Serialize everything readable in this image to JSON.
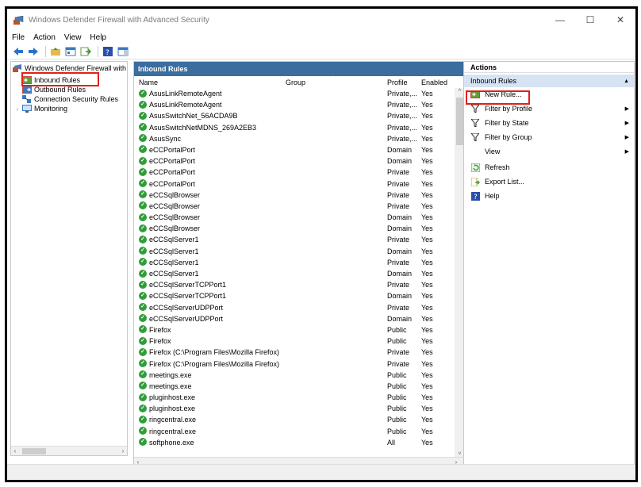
{
  "window": {
    "title": "Windows Defender Firewall with Advanced Security",
    "minimize": "—",
    "maximize": "☐",
    "close": "✕"
  },
  "menu": [
    "File",
    "Action",
    "View",
    "Help"
  ],
  "tree": {
    "root": "Windows Defender Firewall with",
    "inbound": "Inbound Rules",
    "outbound": "Outbound Rules",
    "connection": "Connection Security Rules",
    "monitoring": "Monitoring"
  },
  "center": {
    "header": "Inbound Rules",
    "columns": {
      "name": "Name",
      "group": "Group",
      "profile": "Profile",
      "enabled": "Enabled"
    },
    "rows": [
      {
        "name": "AsusLinkRemoteAgent",
        "profile": "Private,...",
        "enabled": "Yes"
      },
      {
        "name": "AsusLinkRemoteAgent",
        "profile": "Private,...",
        "enabled": "Yes"
      },
      {
        "name": "AsusSwitchNet_56ACDA9B",
        "profile": "Private,...",
        "enabled": "Yes"
      },
      {
        "name": "AsusSwitchNetMDNS_269A2EB3",
        "profile": "Private,...",
        "enabled": "Yes"
      },
      {
        "name": "AsusSync",
        "profile": "Private,...",
        "enabled": "Yes"
      },
      {
        "name": "eCCPortalPort",
        "profile": "Domain",
        "enabled": "Yes"
      },
      {
        "name": "eCCPortalPort",
        "profile": "Domain",
        "enabled": "Yes"
      },
      {
        "name": "eCCPortalPort",
        "profile": "Private",
        "enabled": "Yes"
      },
      {
        "name": "eCCPortalPort",
        "profile": "Private",
        "enabled": "Yes"
      },
      {
        "name": "eCCSqlBrowser",
        "profile": "Private",
        "enabled": "Yes"
      },
      {
        "name": "eCCSqlBrowser",
        "profile": "Private",
        "enabled": "Yes"
      },
      {
        "name": "eCCSqlBrowser",
        "profile": "Domain",
        "enabled": "Yes"
      },
      {
        "name": "eCCSqlBrowser",
        "profile": "Domain",
        "enabled": "Yes"
      },
      {
        "name": "eCCSqlServer1",
        "profile": "Private",
        "enabled": "Yes"
      },
      {
        "name": "eCCSqlServer1",
        "profile": "Domain",
        "enabled": "Yes"
      },
      {
        "name": "eCCSqlServer1",
        "profile": "Private",
        "enabled": "Yes"
      },
      {
        "name": "eCCSqlServer1",
        "profile": "Domain",
        "enabled": "Yes"
      },
      {
        "name": "eCCSqlServerTCPPort1",
        "profile": "Private",
        "enabled": "Yes"
      },
      {
        "name": "eCCSqlServerTCPPort1",
        "profile": "Domain",
        "enabled": "Yes"
      },
      {
        "name": "eCCSqlServerUDPPort",
        "profile": "Private",
        "enabled": "Yes"
      },
      {
        "name": "eCCSqlServerUDPPort",
        "profile": "Domain",
        "enabled": "Yes"
      },
      {
        "name": "Firefox",
        "profile": "Public",
        "enabled": "Yes"
      },
      {
        "name": "Firefox",
        "profile": "Public",
        "enabled": "Yes"
      },
      {
        "name": "Firefox (C:\\Program Files\\Mozilla Firefox)",
        "profile": "Private",
        "enabled": "Yes"
      },
      {
        "name": "Firefox (C:\\Program Files\\Mozilla Firefox)",
        "profile": "Private",
        "enabled": "Yes"
      },
      {
        "name": "meetings.exe",
        "profile": "Public",
        "enabled": "Yes"
      },
      {
        "name": "meetings.exe",
        "profile": "Public",
        "enabled": "Yes"
      },
      {
        "name": "pluginhost.exe",
        "profile": "Public",
        "enabled": "Yes"
      },
      {
        "name": "pluginhost.exe",
        "profile": "Public",
        "enabled": "Yes"
      },
      {
        "name": "ringcentral.exe",
        "profile": "Public",
        "enabled": "Yes"
      },
      {
        "name": "ringcentral.exe",
        "profile": "Public",
        "enabled": "Yes"
      },
      {
        "name": "softphone.exe",
        "profile": "All",
        "enabled": "Yes"
      }
    ]
  },
  "actions": {
    "title": "Actions",
    "group": "Inbound Rules",
    "items": [
      {
        "label": "New Rule...",
        "icon": "new-rule-icon"
      },
      {
        "label": "Filter by Profile",
        "icon": "filter-icon",
        "submenu": true
      },
      {
        "label": "Filter by State",
        "icon": "filter-icon",
        "submenu": true
      },
      {
        "label": "Filter by Group",
        "icon": "filter-icon",
        "submenu": true
      },
      {
        "label": "View",
        "icon": "",
        "submenu": true
      },
      {
        "label": "Refresh",
        "icon": "refresh-icon"
      },
      {
        "label": "Export List...",
        "icon": "export-icon"
      },
      {
        "label": "Help",
        "icon": "help-icon"
      }
    ]
  },
  "colors": {
    "header": "#3b6d9e",
    "highlight": "#e0201a",
    "group_bg": "#d5e3f2",
    "check": "#2f9e3a"
  }
}
